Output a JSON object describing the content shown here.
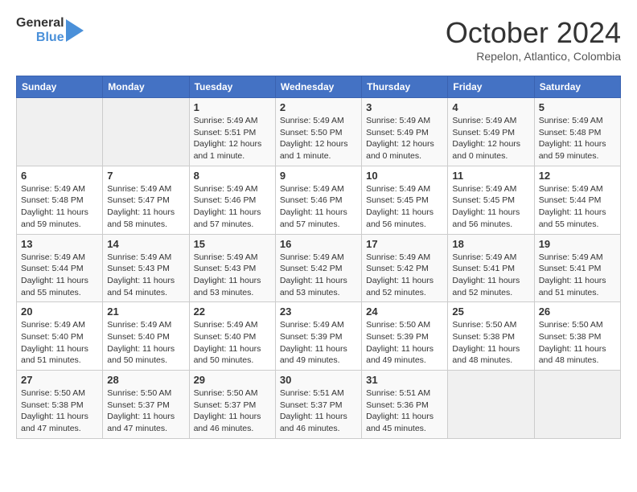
{
  "header": {
    "logo_line1": "General",
    "logo_line2": "Blue",
    "month_title": "October 2024",
    "subtitle": "Repelon, Atlantico, Colombia"
  },
  "columns": [
    "Sunday",
    "Monday",
    "Tuesday",
    "Wednesday",
    "Thursday",
    "Friday",
    "Saturday"
  ],
  "weeks": [
    [
      {
        "day": "",
        "info": ""
      },
      {
        "day": "",
        "info": ""
      },
      {
        "day": "1",
        "info": "Sunrise: 5:49 AM\nSunset: 5:51 PM\nDaylight: 12 hours and 1 minute."
      },
      {
        "day": "2",
        "info": "Sunrise: 5:49 AM\nSunset: 5:50 PM\nDaylight: 12 hours and 1 minute."
      },
      {
        "day": "3",
        "info": "Sunrise: 5:49 AM\nSunset: 5:49 PM\nDaylight: 12 hours and 0 minutes."
      },
      {
        "day": "4",
        "info": "Sunrise: 5:49 AM\nSunset: 5:49 PM\nDaylight: 12 hours and 0 minutes."
      },
      {
        "day": "5",
        "info": "Sunrise: 5:49 AM\nSunset: 5:48 PM\nDaylight: 11 hours and 59 minutes."
      }
    ],
    [
      {
        "day": "6",
        "info": "Sunrise: 5:49 AM\nSunset: 5:48 PM\nDaylight: 11 hours and 59 minutes."
      },
      {
        "day": "7",
        "info": "Sunrise: 5:49 AM\nSunset: 5:47 PM\nDaylight: 11 hours and 58 minutes."
      },
      {
        "day": "8",
        "info": "Sunrise: 5:49 AM\nSunset: 5:46 PM\nDaylight: 11 hours and 57 minutes."
      },
      {
        "day": "9",
        "info": "Sunrise: 5:49 AM\nSunset: 5:46 PM\nDaylight: 11 hours and 57 minutes."
      },
      {
        "day": "10",
        "info": "Sunrise: 5:49 AM\nSunset: 5:45 PM\nDaylight: 11 hours and 56 minutes."
      },
      {
        "day": "11",
        "info": "Sunrise: 5:49 AM\nSunset: 5:45 PM\nDaylight: 11 hours and 56 minutes."
      },
      {
        "day": "12",
        "info": "Sunrise: 5:49 AM\nSunset: 5:44 PM\nDaylight: 11 hours and 55 minutes."
      }
    ],
    [
      {
        "day": "13",
        "info": "Sunrise: 5:49 AM\nSunset: 5:44 PM\nDaylight: 11 hours and 55 minutes."
      },
      {
        "day": "14",
        "info": "Sunrise: 5:49 AM\nSunset: 5:43 PM\nDaylight: 11 hours and 54 minutes."
      },
      {
        "day": "15",
        "info": "Sunrise: 5:49 AM\nSunset: 5:43 PM\nDaylight: 11 hours and 53 minutes."
      },
      {
        "day": "16",
        "info": "Sunrise: 5:49 AM\nSunset: 5:42 PM\nDaylight: 11 hours and 53 minutes."
      },
      {
        "day": "17",
        "info": "Sunrise: 5:49 AM\nSunset: 5:42 PM\nDaylight: 11 hours and 52 minutes."
      },
      {
        "day": "18",
        "info": "Sunrise: 5:49 AM\nSunset: 5:41 PM\nDaylight: 11 hours and 52 minutes."
      },
      {
        "day": "19",
        "info": "Sunrise: 5:49 AM\nSunset: 5:41 PM\nDaylight: 11 hours and 51 minutes."
      }
    ],
    [
      {
        "day": "20",
        "info": "Sunrise: 5:49 AM\nSunset: 5:40 PM\nDaylight: 11 hours and 51 minutes."
      },
      {
        "day": "21",
        "info": "Sunrise: 5:49 AM\nSunset: 5:40 PM\nDaylight: 11 hours and 50 minutes."
      },
      {
        "day": "22",
        "info": "Sunrise: 5:49 AM\nSunset: 5:40 PM\nDaylight: 11 hours and 50 minutes."
      },
      {
        "day": "23",
        "info": "Sunrise: 5:49 AM\nSunset: 5:39 PM\nDaylight: 11 hours and 49 minutes."
      },
      {
        "day": "24",
        "info": "Sunrise: 5:50 AM\nSunset: 5:39 PM\nDaylight: 11 hours and 49 minutes."
      },
      {
        "day": "25",
        "info": "Sunrise: 5:50 AM\nSunset: 5:38 PM\nDaylight: 11 hours and 48 minutes."
      },
      {
        "day": "26",
        "info": "Sunrise: 5:50 AM\nSunset: 5:38 PM\nDaylight: 11 hours and 48 minutes."
      }
    ],
    [
      {
        "day": "27",
        "info": "Sunrise: 5:50 AM\nSunset: 5:38 PM\nDaylight: 11 hours and 47 minutes."
      },
      {
        "day": "28",
        "info": "Sunrise: 5:50 AM\nSunset: 5:37 PM\nDaylight: 11 hours and 47 minutes."
      },
      {
        "day": "29",
        "info": "Sunrise: 5:50 AM\nSunset: 5:37 PM\nDaylight: 11 hours and 46 minutes."
      },
      {
        "day": "30",
        "info": "Sunrise: 5:51 AM\nSunset: 5:37 PM\nDaylight: 11 hours and 46 minutes."
      },
      {
        "day": "31",
        "info": "Sunrise: 5:51 AM\nSunset: 5:36 PM\nDaylight: 11 hours and 45 minutes."
      },
      {
        "day": "",
        "info": ""
      },
      {
        "day": "",
        "info": ""
      }
    ]
  ]
}
